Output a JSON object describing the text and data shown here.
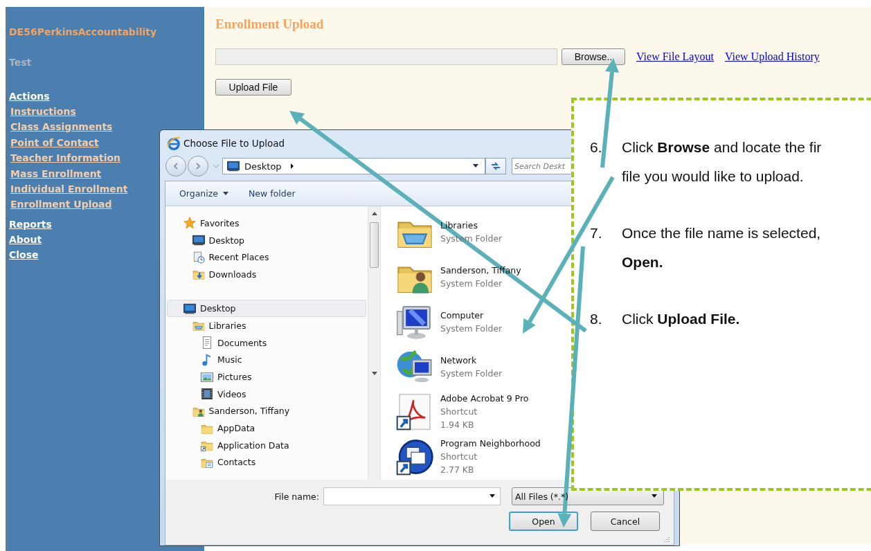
{
  "sidebar": {
    "app_title": "DE56PerkinsAccountability",
    "subtitle": "Test",
    "menu": [
      {
        "label": "Actions",
        "children": [
          {
            "label": "Instructions"
          },
          {
            "label": "Class Assignments"
          },
          {
            "label": "Point of Contact"
          },
          {
            "label": "Teacher Information"
          },
          {
            "label": "Mass Enrollment"
          },
          {
            "label": "Individual Enrollment"
          },
          {
            "label": "Enrollment Upload"
          }
        ]
      },
      {
        "label": "Reports"
      },
      {
        "label": "About"
      },
      {
        "label": "Close"
      }
    ]
  },
  "main": {
    "heading": "Enrollment Upload",
    "browse_button": "Browse..",
    "links": [
      "View File Layout",
      "View Upload History"
    ],
    "upload_button": "Upload File"
  },
  "dialog": {
    "title": "Choose File to Upload",
    "address": "Desktop",
    "search": {
      "placeholder": "Search Deskt"
    },
    "toolbar": [
      {
        "label": "Organize",
        "kind": "menu"
      },
      {
        "label": "New folder",
        "kind": "button"
      }
    ],
    "nav_pane": {
      "items": [
        {
          "label": "Favorites",
          "kind": "star",
          "selected": false,
          "children": [
            {
              "label": "Desktop",
              "kind": "desktop",
              "selected": false
            },
            {
              "label": "Recent Places",
              "kind": "recent",
              "selected": false
            },
            {
              "label": "Downloads",
              "kind": "downloads",
              "selected": false
            }
          ]
        },
        {
          "label": "Desktop",
          "kind": "desktop",
          "selected": true,
          "children": [
            {
              "label": "Libraries",
              "kind": "libraries",
              "selected": false,
              "children": [
                {
                  "label": "Documents",
                  "kind": "documents",
                  "selected": false
                },
                {
                  "label": "Music",
                  "kind": "music",
                  "selected": false
                },
                {
                  "label": "Pictures",
                  "kind": "pictures",
                  "selected": false
                },
                {
                  "label": "Videos",
                  "kind": "videos",
                  "selected": false
                }
              ]
            },
            {
              "label": "Sanderson, Tiffany",
              "kind": "user-folder",
              "selected": false,
              "children": [
                {
                  "label": "AppData",
                  "kind": "folder",
                  "selected": false
                },
                {
                  "label": "Application Data",
                  "kind": "shortcut-folder",
                  "selected": false
                },
                {
                  "label": "Contacts",
                  "kind": "contacts",
                  "selected": false
                }
              ]
            }
          ]
        }
      ]
    },
    "files": [
      {
        "name": "Libraries",
        "type": "System Folder",
        "kind": "libraries"
      },
      {
        "name": "Sanderson, Tiffany",
        "type": "System Folder",
        "kind": "user-folder"
      },
      {
        "name": "Computer",
        "type": "System Folder",
        "kind": "computer"
      },
      {
        "name": "Network",
        "type": "System Folder",
        "kind": "network"
      },
      {
        "name": "Adobe Acrobat 9 Pro",
        "type": "Shortcut",
        "size": "1.94 KB",
        "kind": "pdf-shortcut"
      },
      {
        "name": "Program Neighborhood",
        "type": "Shortcut",
        "size": "2.77 KB",
        "kind": "app-shortcut"
      }
    ],
    "file_name_label": "File name:",
    "filter": "All Files (*.*)",
    "buttons": [
      {
        "label": "Open",
        "default": true
      },
      {
        "label": "Cancel",
        "default": false
      }
    ]
  },
  "instructions": [
    {
      "number": "6.",
      "lines": [
        "Click **Browse** and locate the fir",
        "file you would like to upload."
      ]
    },
    {
      "number": "7.",
      "lines": [
        "Once the file name is selected,",
        "**Open.**"
      ]
    },
    {
      "number": "8.",
      "lines": [
        "Click **Upload File.**"
      ]
    }
  ]
}
